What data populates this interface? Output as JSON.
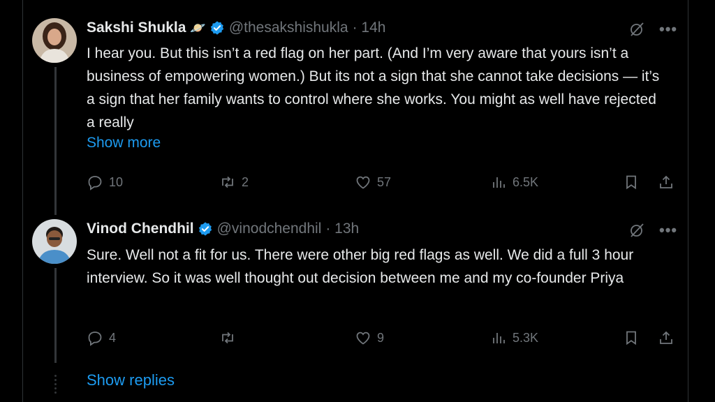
{
  "tweets": [
    {
      "name": "Sakshi Shukla",
      "emoji": "🪐",
      "handle": "@thesakshishukla",
      "time": "· 14h",
      "text": "I hear you. But this isn’t a red flag on her part. (And I’m very aware that yours isn’t a business of empowering women.) But its not a sign that she cannot take decisions — it’s a sign that her family wants to control where she works. You might as well have rejected a really",
      "show_more": "Show more",
      "replies": "10",
      "retweets": "2",
      "likes": "57",
      "views": "6.5K"
    },
    {
      "name": "Vinod Chendhil",
      "handle": "@vinodchendhil",
      "time": "· 13h",
      "text": "Sure. Well not a fit for us. There were other big red flags as well. We did a full 3 hour interview. So it was well thought out decision between me and my co-founder Priya",
      "replies": "4",
      "retweets": "",
      "likes": "9",
      "views": "5.3K"
    }
  ],
  "more_icon": "•••",
  "show_replies": "Show replies",
  "colors": {
    "background": "#000000",
    "text": "#e7e9ea",
    "muted": "#71767b",
    "accent": "#1d9bf0",
    "verified": "#1d9bf0"
  },
  "icons": [
    "grok-icon",
    "more-icon",
    "reply-icon",
    "retweet-icon",
    "like-icon",
    "views-icon",
    "bookmark-icon",
    "share-icon",
    "verified-icon"
  ]
}
